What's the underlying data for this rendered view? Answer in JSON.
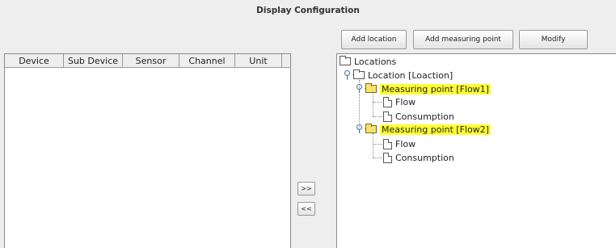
{
  "window": {
    "title": "Display Configuration"
  },
  "toolbar": {
    "add_location": "Add location",
    "add_measuring_point": "Add measuring point",
    "modify": "Modify"
  },
  "transfer": {
    "move_right": ">>",
    "move_left": "<<"
  },
  "table": {
    "columns": [
      "Device",
      "Sub Device",
      "Sensor",
      "Channel",
      "Unit"
    ],
    "rows": []
  },
  "tree": {
    "root": "Locations",
    "location": "Location [Loaction]",
    "mp1": {
      "label": "Measuring point [Flow1]",
      "children": [
        "Flow",
        "Consumption"
      ]
    },
    "mp2": {
      "label": "Measuring point [Flow2]",
      "children": [
        "Flow",
        "Consumption"
      ]
    }
  },
  "colors": {
    "highlight": "#ffff33",
    "background": "#eeeeee"
  }
}
